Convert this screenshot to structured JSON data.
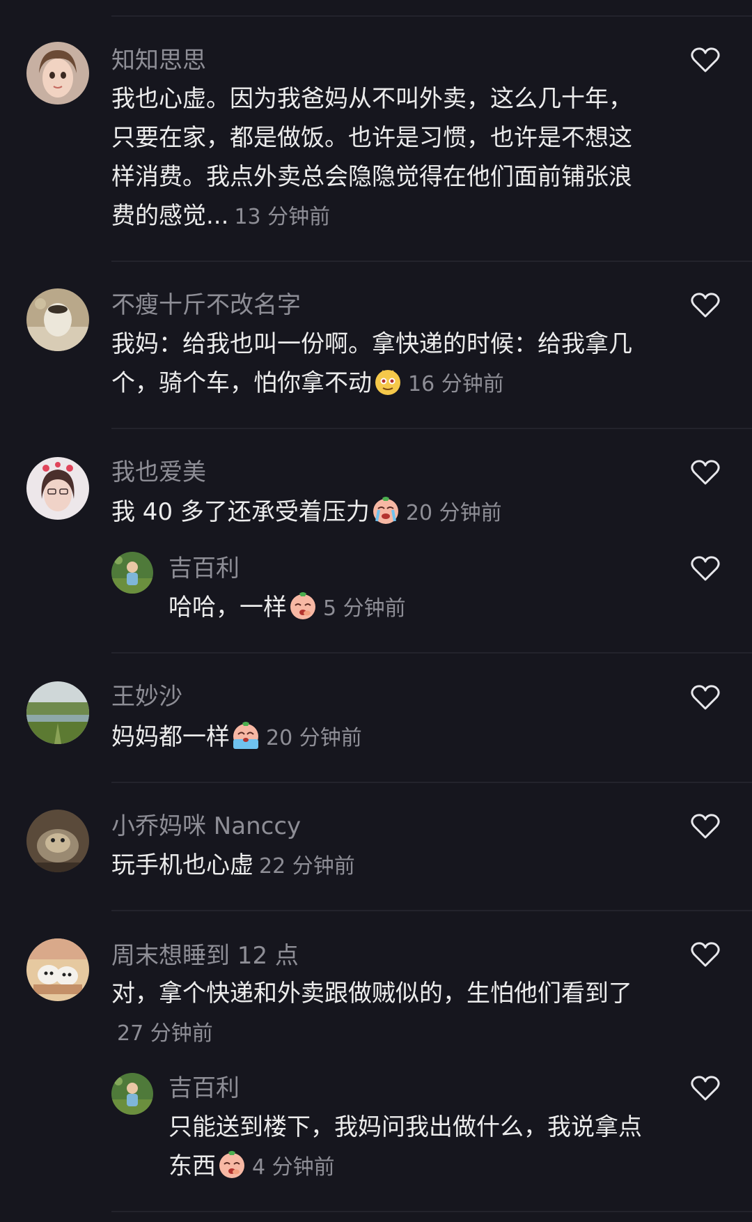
{
  "comments": [
    {
      "username": "知知思思",
      "text": "我也心虚。因为我爸妈从不叫外卖，这么几十年，只要在家，都是做饭。也许是习惯，也许是不想这样消费。我点外卖总会隐隐觉得在他们面前铺张浪费的感觉...",
      "time": "13 分钟前"
    },
    {
      "username": "不瘦十斤不改名字",
      "text": "我妈：给我也叫一份啊。拿快递的时候：给我拿几个，骑个车，怕你拿不动",
      "emoji": "sly-face-emoji",
      "time": "16 分钟前"
    },
    {
      "username": "我也爱美",
      "text": "我 40 多了还承受着压力",
      "emoji": "crying-face-emoji",
      "time": "20 分钟前"
    },
    {
      "username": "吉百利",
      "text": "哈哈，一样",
      "emoji": "giggle-face-emoji",
      "time": "5 分钟前"
    },
    {
      "username": "王妙沙",
      "text": "妈妈都一样",
      "emoji": "tearful-face-emoji",
      "time": "20 分钟前"
    },
    {
      "username": "小乔妈咪 Nanccy",
      "text": "玩手机也心虚",
      "time": "22 分钟前"
    },
    {
      "username": "周末想睡到 12 点",
      "text": "对，拿个快递和外卖跟做贼似的，生怕他们看到了",
      "time": "27 分钟前"
    },
    {
      "username": "吉百利",
      "text": "只能送到楼下，我妈问我出做什么，我说拿点东西",
      "emoji": "giggle-face-emoji",
      "time": "4 分钟前"
    }
  ],
  "icons": {
    "like": "heart-outline-icon"
  },
  "colors": {
    "background": "#16161e",
    "text": "#ececec",
    "muted": "#8e8e96",
    "divider": "#23232c"
  }
}
